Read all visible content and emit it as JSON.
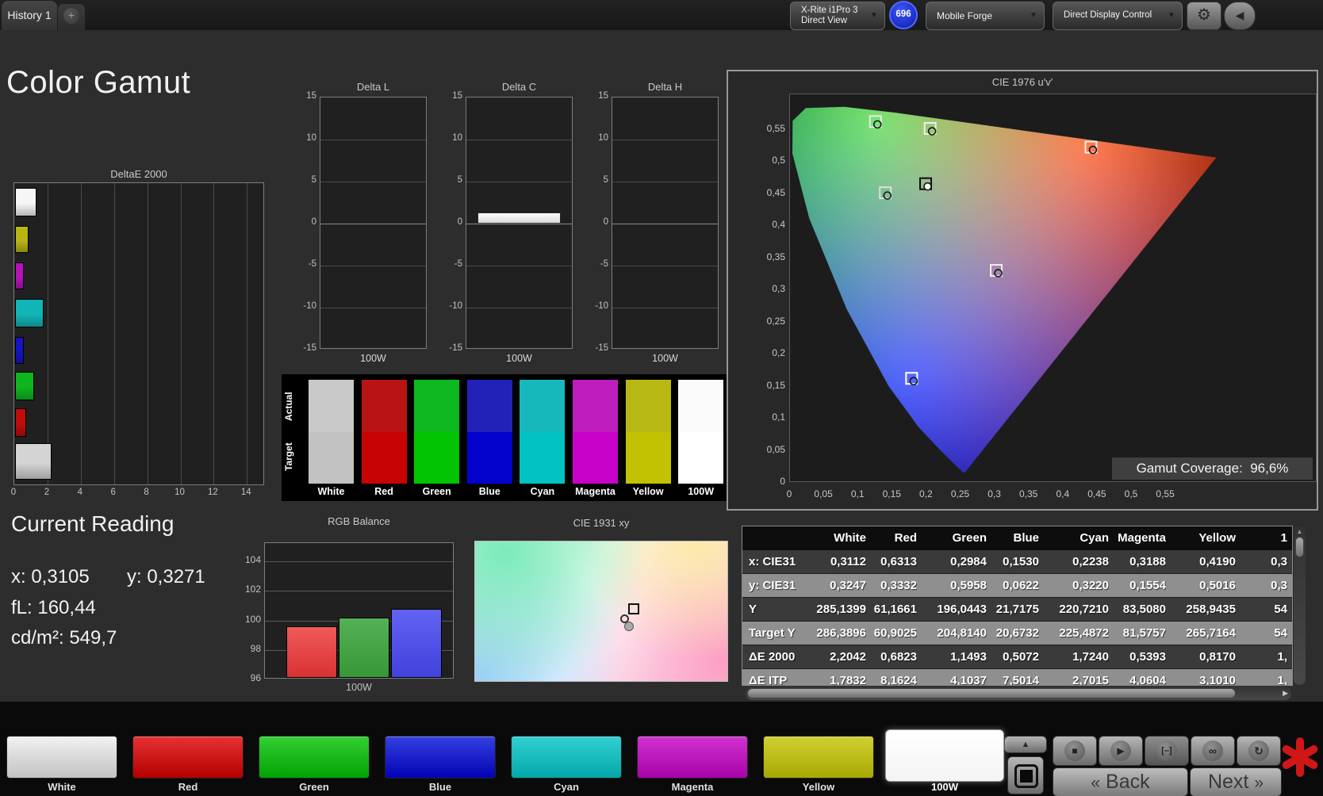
{
  "topbar": {
    "tab": "History 1",
    "plus": "+",
    "meter": {
      "line1": "X-Rite i1Pro 3",
      "line2": "Direct View",
      "stripe": "#35c935",
      "count": "696"
    },
    "source": {
      "label": "Mobile Forge",
      "stripe": "#d6d6d6"
    },
    "workflow": {
      "label": "Direct Display Control",
      "stripe": "#e6da1e"
    }
  },
  "page_title": "Color Gamut",
  "chart_data": [
    {
      "type": "bar",
      "name": "deltae2000",
      "title": "DeltaE 2000",
      "orientation": "horizontal",
      "xticks": [
        "0",
        "2",
        "4",
        "6",
        "8",
        "10",
        "12",
        "14"
      ],
      "xlim": [
        0,
        15.1
      ],
      "bars": [
        {
          "name": "100W",
          "value": 1.3,
          "color": "#f6f6f6"
        },
        {
          "name": "Yellow",
          "value": 0.82,
          "color": "#b9b512"
        },
        {
          "name": "Magenta",
          "value": 0.54,
          "color": "#b713b7"
        },
        {
          "name": "Cyan",
          "value": 1.72,
          "color": "#12b5b5"
        },
        {
          "name": "Blue",
          "value": 0.51,
          "color": "#1414c3"
        },
        {
          "name": "Green",
          "value": 1.15,
          "color": "#0fb51f"
        },
        {
          "name": "Red",
          "value": 0.68,
          "color": "#c00c0c"
        },
        {
          "name": "White",
          "value": 2.2,
          "color": "#d4d4d4"
        }
      ]
    },
    {
      "type": "bar",
      "name": "delta_lch",
      "yticks": [
        "15",
        "10",
        "5",
        "0",
        "-5",
        "-10",
        "-15"
      ],
      "ylim": [
        -15,
        15
      ],
      "charts": [
        {
          "title": "Delta L",
          "xlabel": "100W",
          "value": 0
        },
        {
          "title": "Delta C",
          "xlabel": "100W",
          "value": 1.35
        },
        {
          "title": "Delta H",
          "xlabel": "100W",
          "value": 0
        }
      ]
    },
    {
      "type": "scatter",
      "name": "cie1976",
      "title": "CIE 1976 u'v'",
      "xticks": [
        "0",
        "0,05",
        "0,1",
        "0,15",
        "0,2",
        "0,25",
        "0,3",
        "0,35",
        "0,4",
        "0,45",
        "0,5",
        "0,55"
      ],
      "yticks": [
        "0",
        "0,05",
        "0,1",
        "0,15",
        "0,2",
        "0,25",
        "0,3",
        "0,35",
        "0,4",
        "0,45",
        "0,5",
        "0,55"
      ],
      "coverage_label": "Gamut Coverage:",
      "coverage_value": "96,6%",
      "points": [
        {
          "name": "white",
          "u": 0.1984,
          "v": 0.4658,
          "square_stroke": "#0d0d0d",
          "circle_fill": "#ffffff"
        },
        {
          "name": "red",
          "u": 0.4402,
          "v": 0.5228,
          "square_stroke": "#f0f0f0",
          "circle_fill": "none"
        },
        {
          "name": "green",
          "u": 0.125,
          "v": 0.5625,
          "square_stroke": "#e8e8e8",
          "circle_fill": "none"
        },
        {
          "name": "blue",
          "u": 0.1779,
          "v": 0.1627,
          "square_stroke": "#ffffff",
          "circle_fill": "none"
        },
        {
          "name": "cyan",
          "u": 0.1395,
          "v": 0.4517,
          "square_stroke": "#dfdfdf",
          "circle_fill": "none"
        },
        {
          "name": "magenta",
          "u": 0.3017,
          "v": 0.3308,
          "square_stroke": "#f0f0f0",
          "circle_fill": "none"
        },
        {
          "name": "yellow",
          "u": 0.2049,
          "v": 0.5518,
          "square_stroke": "#f0f0f0",
          "circle_fill": "none"
        }
      ]
    },
    {
      "type": "bar",
      "name": "rgb_balance",
      "title": "RGB Balance",
      "yticks": [
        "104",
        "102",
        "100",
        "98",
        "96"
      ],
      "ylim": [
        96,
        105.2
      ],
      "xlabel": "100W",
      "bars": [
        {
          "name": "red",
          "value": 99.5,
          "color_top": "#f05a5a",
          "color_bot": "#d93232"
        },
        {
          "name": "green",
          "value": 100.1,
          "color_top": "#56b056",
          "color_bot": "#379837"
        },
        {
          "name": "blue",
          "value": 100.7,
          "color_top": "#6262f2",
          "color_bot": "#4242dd"
        }
      ]
    },
    {
      "type": "scatter",
      "name": "cie1931",
      "title": "CIE 1931 xy"
    }
  ],
  "swatch_strip": {
    "row_labels": [
      "Actual",
      "Target"
    ],
    "items": [
      {
        "label": "White",
        "actual": "#c9c9c9",
        "target": "#c2c2c2"
      },
      {
        "label": "Red",
        "actual": "#b81414",
        "target": "#c70303"
      },
      {
        "label": "Green",
        "actual": "#0cb81e",
        "target": "#02c402"
      },
      {
        "label": "Blue",
        "actual": "#2222b8",
        "target": "#0202cc"
      },
      {
        "label": "Cyan",
        "actual": "#17b8bc",
        "target": "#02c2c2"
      },
      {
        "label": "Magenta",
        "actual": "#bc1dbc",
        "target": "#c802c8"
      },
      {
        "label": "Yellow",
        "actual": "#b8b814",
        "target": "#c2c202"
      },
      {
        "label": "100W",
        "actual": "#fbfbfb",
        "target": "#ffffff"
      }
    ]
  },
  "current_reading": {
    "title": "Current Reading",
    "x": "x: 0,3105",
    "y": "y: 0,3271",
    "fl": "fL: 160,44",
    "cd": "cd/m²: 549,7"
  },
  "table": {
    "headers": [
      "",
      "White",
      "Red",
      "Green",
      "Blue",
      "Cyan",
      "Magenta",
      "Yellow",
      "1"
    ],
    "rows": [
      {
        "label": "x: CIE31",
        "shade": "dark",
        "values": [
          "0,3112",
          "0,6313",
          "0,2984",
          "0,1530",
          "0,2238",
          "0,3188",
          "0,4190",
          "0,3"
        ]
      },
      {
        "label": "y: CIE31",
        "shade": "light",
        "values": [
          "0,3247",
          "0,3332",
          "0,5958",
          "0,0622",
          "0,3220",
          "0,1554",
          "0,5016",
          "0,3"
        ]
      },
      {
        "label": "Y",
        "shade": "dark",
        "values": [
          "285,1399",
          "61,1661",
          "196,0443",
          "21,7175",
          "220,7210",
          "83,5080",
          "258,9435",
          "54"
        ]
      },
      {
        "label": "Target Y",
        "shade": "light",
        "values": [
          "286,3896",
          "60,9025",
          "204,8140",
          "20,6732",
          "225,4872",
          "81,5757",
          "265,7164",
          "54"
        ]
      },
      {
        "label": "ΔE 2000",
        "shade": "dark",
        "values": [
          "2,2042",
          "0,6823",
          "1,1493",
          "0,5072",
          "1,7240",
          "0,5393",
          "0,8170",
          "1,"
        ]
      },
      {
        "label": "ΔE ITP",
        "shade": "light",
        "values": [
          "1,7832",
          "8,1624",
          "4,1037",
          "7,5014",
          "2,7015",
          "4,0604",
          "3,1010",
          "1,"
        ]
      }
    ]
  },
  "bottom": {
    "patterns": [
      {
        "label": "White",
        "top": "#f2f2f2",
        "bot": "#c2c2c2"
      },
      {
        "label": "Red",
        "top": "#e63232",
        "bot": "#b50000"
      },
      {
        "label": "Green",
        "top": "#32d032",
        "bot": "#03a203"
      },
      {
        "label": "Blue",
        "top": "#3340e0",
        "bot": "#0303b5"
      },
      {
        "label": "Cyan",
        "top": "#32d0d0",
        "bot": "#03a8a8"
      },
      {
        "label": "Magenta",
        "top": "#d032d0",
        "bot": "#a803a8"
      },
      {
        "label": "Yellow",
        "top": "#d0d032",
        "bot": "#a8a803"
      },
      {
        "label": "100W",
        "top": "#ffffff",
        "bot": "#f4f4f4"
      }
    ],
    "back": "Back",
    "next": "Next",
    "back_glyph": "«",
    "next_glyph": "»"
  }
}
